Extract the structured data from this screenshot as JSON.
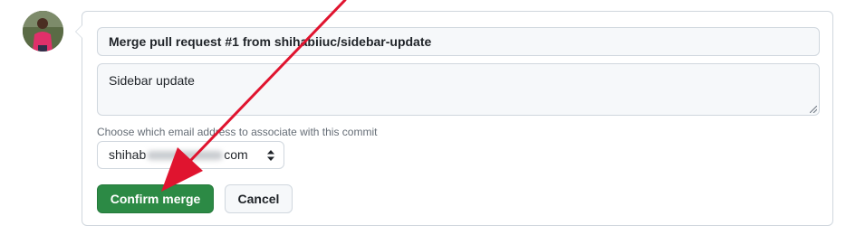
{
  "merge_form": {
    "title_value": "Merge pull request #1 from shihabiiuc/sidebar-update",
    "body_value": "Sidebar update",
    "email_label": "Choose which email address to associate with this commit",
    "email_select": {
      "visible_prefix": "shihab",
      "visible_suffix": "com"
    },
    "confirm_label": "Confirm merge",
    "cancel_label": "Cancel"
  },
  "colors": {
    "confirm_green": "#2c8a45",
    "annotation_arrow": "#e0142f"
  },
  "icons": {
    "avatar": "user-avatar",
    "select_arrows": "updown-chevron-icon",
    "resize": "resize-handle-icon",
    "annotation": "annotation-arrow"
  }
}
